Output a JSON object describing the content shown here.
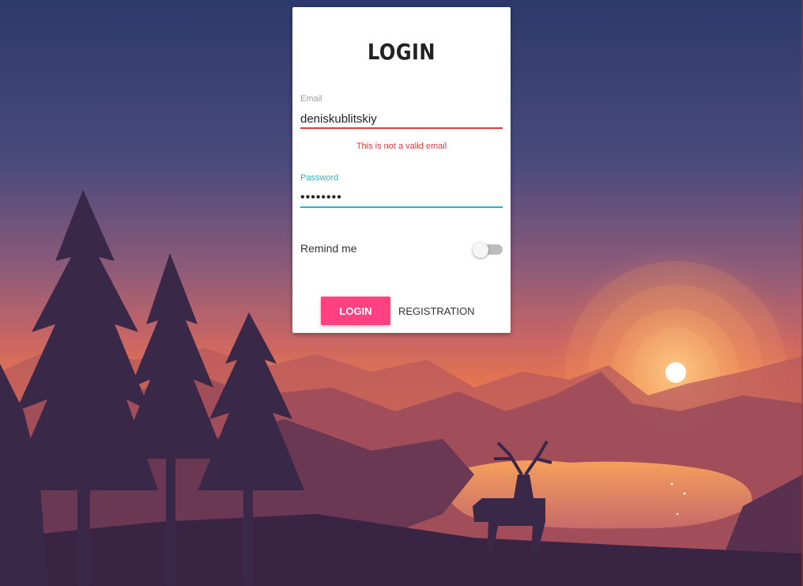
{
  "login_card": {
    "title": "LOGIN",
    "email": {
      "label": "Email",
      "value": "deniskublitskiy",
      "error": "This is not a valid email"
    },
    "password": {
      "label": "Password",
      "value": "••••••••"
    },
    "remind_me": {
      "label": "Remind me",
      "enabled": false
    },
    "buttons": {
      "login": "LOGIN",
      "registration": "REGISTRATION"
    }
  },
  "colors": {
    "accent_pink": "#ff4081",
    "focus_cyan": "#1eb6d3",
    "error_red": "#e53935"
  }
}
